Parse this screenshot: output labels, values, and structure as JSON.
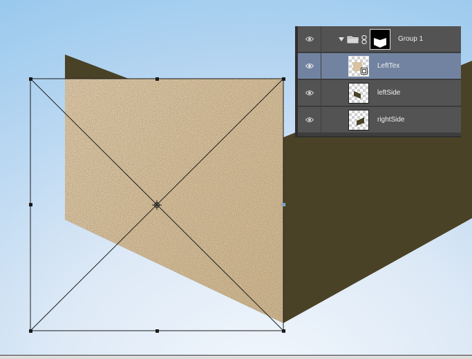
{
  "layers_panel": {
    "layers": [
      {
        "name": "Group 1",
        "type": "group",
        "expanded": true,
        "visible": true,
        "selected": false
      },
      {
        "name": "LeftTex",
        "type": "smart-object",
        "visible": true,
        "selected": true
      },
      {
        "name": "leftSide",
        "type": "layer",
        "visible": true,
        "selected": false
      },
      {
        "name": "rightSide",
        "type": "layer",
        "visible": true,
        "selected": false
      }
    ],
    "icons": {
      "visibility": "eye-icon",
      "expand": "triangle-down-icon",
      "group": "folder-icon",
      "mask_link": "chain-link-icon",
      "smart_object_badge": "smart-object-icon"
    }
  },
  "colors": {
    "shape_dark": "#4a4226",
    "texture": "#d8c29f",
    "panel_bg": "#535353",
    "selected_row": "#7183a0",
    "panel_text": "#f0f0f0"
  }
}
